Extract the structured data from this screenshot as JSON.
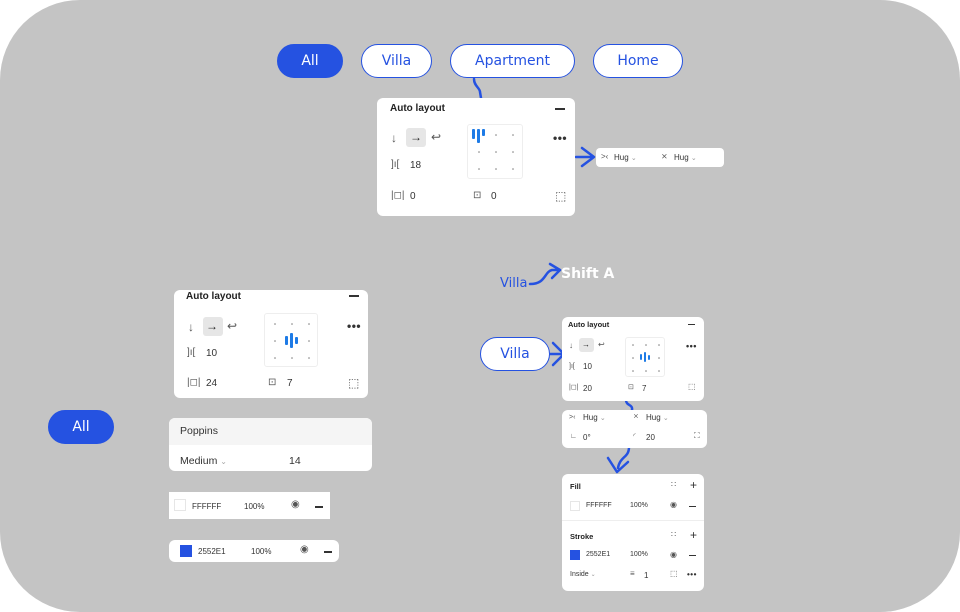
{
  "colors": {
    "accent": "#2552e1",
    "canvas": "#c4c4c4",
    "align_bar": "#1e7be6"
  },
  "top_filters": [
    {
      "label": "All",
      "active": true
    },
    {
      "label": "Villa",
      "active": false
    },
    {
      "label": "Apartment",
      "active": false
    },
    {
      "label": "Home",
      "active": false
    }
  ],
  "side_filter": {
    "label": "All",
    "active": true
  },
  "auto_layout_top": {
    "title": "Auto layout",
    "direction_icons": [
      "arrow-down-icon",
      "arrow-right-icon",
      "wrap-icon"
    ],
    "active_direction": "horizontal",
    "gap": "18",
    "padding_horizontal": "0",
    "padding_vertical": "0",
    "alignment": "top-left"
  },
  "size_row_top": {
    "width_label": "Hug",
    "height_label": "Hug"
  },
  "shortcut": {
    "source": "Villa",
    "keys": "Shift A"
  },
  "auto_layout_left": {
    "title": "Auto layout",
    "gap": "10",
    "padding_horizontal": "24",
    "padding_vertical": "7",
    "alignment": "center"
  },
  "typography": {
    "font": "Poppins",
    "weight": "Medium",
    "size": "14"
  },
  "fill_row_white": {
    "hex": "FFFFFF",
    "opacity": "100%"
  },
  "fill_row_blue": {
    "hex": "2552E1",
    "opacity": "100%"
  },
  "villa_button": {
    "label": "Villa"
  },
  "auto_layout_right": {
    "title": "Auto layout",
    "gap": "10",
    "padding_horizontal": "20",
    "padding_vertical": "7",
    "alignment": "center"
  },
  "size_panel_right": {
    "width_label": "Hug",
    "height_label": "Hug",
    "rotation": "0°",
    "radius": "20"
  },
  "fill_stroke_panel": {
    "fill_title": "Fill",
    "fill": {
      "hex": "FFFFFF",
      "opacity": "100%"
    },
    "stroke_title": "Stroke",
    "stroke": {
      "hex": "2552E1",
      "opacity": "100%"
    },
    "stroke_position": "Inside",
    "stroke_weight": "1"
  }
}
